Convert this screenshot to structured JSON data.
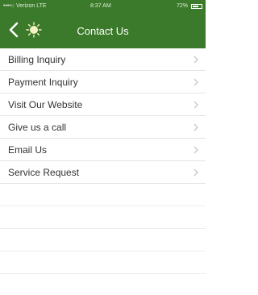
{
  "colors": {
    "header_bg": "#3b7a2a",
    "header_text": "#ffffff",
    "row_text": "#333333",
    "divider": "#e4e4e4",
    "chevron": "#c7c7cc"
  },
  "status_bar": {
    "carrier": "••••○ Verizon LTE",
    "time": "8:37 AM",
    "battery_text": "72%",
    "battery_level": 0.72
  },
  "navbar": {
    "title": "Contact Us",
    "back_icon": "chevron-left-icon",
    "logo_icon": "sun-logo-icon"
  },
  "menu": {
    "items": [
      {
        "label": "Billing Inquiry"
      },
      {
        "label": "Payment Inquiry"
      },
      {
        "label": "Visit Our Website"
      },
      {
        "label": "Give us a call"
      },
      {
        "label": "Email Us"
      },
      {
        "label": "Service Request"
      }
    ],
    "chevron_icon": "chevron-right-icon"
  }
}
